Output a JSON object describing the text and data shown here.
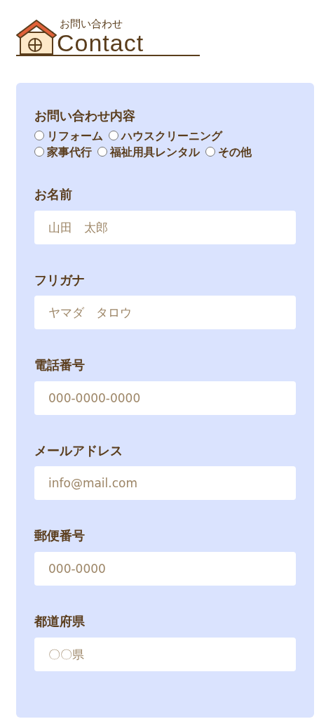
{
  "heading": {
    "subtitle": "お問い合わせ",
    "title": "Contact"
  },
  "inquiry": {
    "label": "お問い合わせ内容",
    "options": [
      {
        "label": "リフォーム",
        "selected": false
      },
      {
        "label": "ハウスクリーニング",
        "selected": false
      },
      {
        "label": "家事代行",
        "selected": false
      },
      {
        "label": "福祉用具レンタル",
        "selected": false
      },
      {
        "label": "その他",
        "selected": false
      }
    ]
  },
  "fields": [
    {
      "label": "お名前",
      "placeholder": "山田　太郎"
    },
    {
      "label": "フリガナ",
      "placeholder": "ヤマダ　タロウ"
    },
    {
      "label": "電話番号",
      "placeholder": "000-0000-0000"
    },
    {
      "label": "メールアドレス",
      "placeholder": "info@mail.com"
    },
    {
      "label": "郵便番号",
      "placeholder": "000-0000"
    },
    {
      "label": "都道府県",
      "placeholder": "〇〇県"
    }
  ]
}
